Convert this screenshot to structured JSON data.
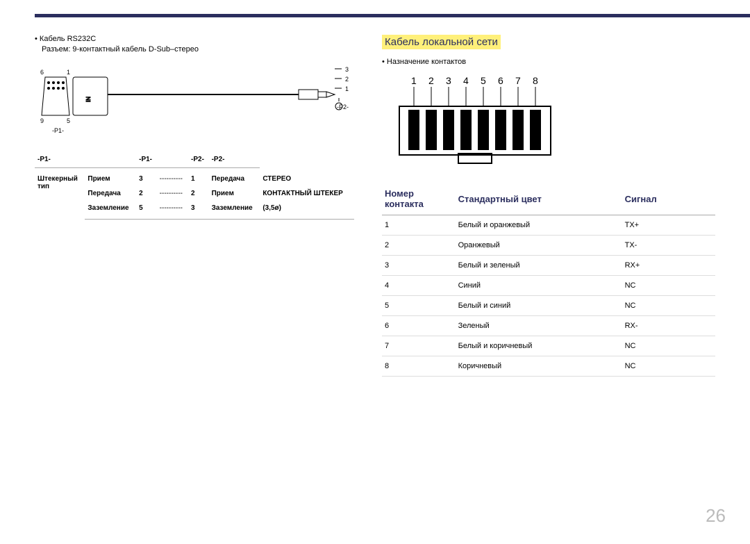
{
  "left": {
    "bullet": "Кабель RS232C",
    "sub": "Разъем: 9-контактный кабель D-Sub–стерео",
    "labels": {
      "p1": "-P1-",
      "p2": "-P2-",
      "pins_left": [
        "6",
        "1",
        "9",
        "5"
      ],
      "pins_right": [
        "3",
        "2",
        "1"
      ]
    },
    "table": {
      "headers": [
        "-P1-",
        "",
        "-P1-",
        "",
        "-P2-",
        "-P2-"
      ],
      "row_label_top": "Штекерный",
      "row_label_bottom": "тип",
      "rows": [
        [
          "Прием",
          "3",
          "----------",
          "1",
          "Передача",
          "СТЕРЕО"
        ],
        [
          "Передача",
          "2",
          "----------",
          "2",
          "Прием",
          "КОНТАКТНЫЙ ШТЕКЕР"
        ],
        [
          "Заземление",
          "5",
          "----------",
          "3",
          "Заземление",
          "(3,5ø)"
        ]
      ]
    }
  },
  "right": {
    "title": "Кабель локальной сети",
    "bullet": "Назначение контактов",
    "pin_numbers": [
      "1",
      "2",
      "3",
      "4",
      "5",
      "6",
      "7",
      "8"
    ],
    "table": {
      "headers": [
        "Номер контакта",
        "Стандартный цвет",
        "Сигнал"
      ],
      "rows": [
        [
          "1",
          "Белый и оранжевый",
          "TX+"
        ],
        [
          "2",
          "Оранжевый",
          "TX-"
        ],
        [
          "3",
          "Белый и зеленый",
          "RX+"
        ],
        [
          "4",
          "Синий",
          "NC"
        ],
        [
          "5",
          "Белый и синий",
          "NC"
        ],
        [
          "6",
          "Зеленый",
          "RX-"
        ],
        [
          "7",
          "Белый и коричневый",
          "NC"
        ],
        [
          "8",
          "Коричневый",
          "NC"
        ]
      ]
    }
  },
  "page_number": "26"
}
